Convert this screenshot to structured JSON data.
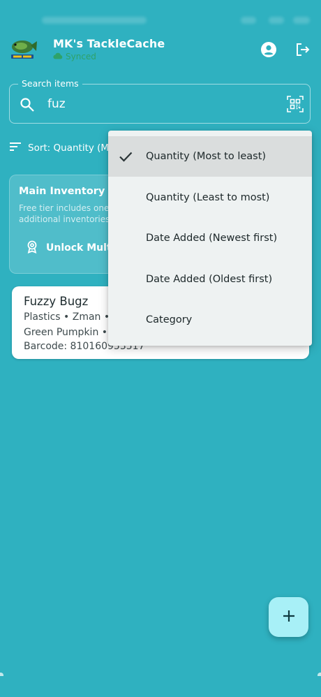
{
  "header": {
    "app_title": "MK's TackleCache",
    "sync_status": "Synced",
    "icons": [
      "app-logo",
      "account-icon",
      "logout-icon"
    ]
  },
  "search": {
    "label": "Search items",
    "value": "fuz",
    "icons": [
      "search-icon",
      "qr-scan-icon"
    ]
  },
  "sort": {
    "label": "Sort: Quantity (M",
    "icon": "sort-lines-icon"
  },
  "inventory": {
    "title": "Main Inventory",
    "description": "Free tier includes one\nadditional inventories",
    "unlock_label": "Unlock Multi",
    "unlock_icon": "badge-icon"
  },
  "items": [
    {
      "name": "Fuzzy Bugz",
      "line1": "Plastics • Zman •",
      "line2": "Green Pumpkin •",
      "line3": "Barcode: 810160953517"
    }
  ],
  "sort_menu": {
    "options": [
      {
        "label": "Quantity (Most to least)",
        "selected": true
      },
      {
        "label": "Quantity (Least to most)",
        "selected": false
      },
      {
        "label": "Date Added (Newest first)",
        "selected": false
      },
      {
        "label": "Date Added (Oldest first)",
        "selected": false
      },
      {
        "label": "Category",
        "selected": false
      }
    ]
  },
  "fab": {
    "icon": "plus-icon"
  },
  "colors": {
    "background": "#2fb1c0",
    "menu_bg": "#eef2f2",
    "selected_bg": "#dadddd",
    "fab_bg": "#a8f0f7",
    "synced_green": "#2ea05a"
  }
}
